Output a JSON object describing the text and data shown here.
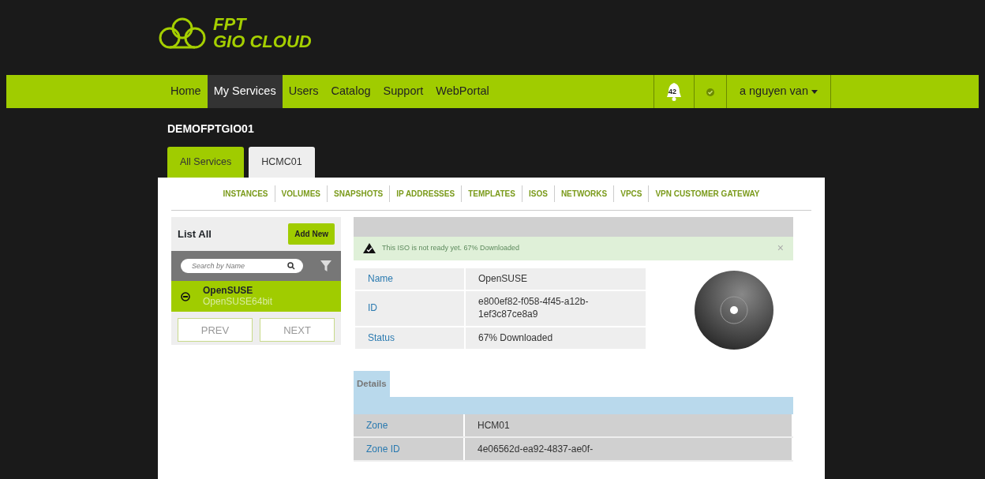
{
  "logo": {
    "line_1": "FPT",
    "line_2": "GIO CLOUD"
  },
  "nav": [
    {
      "label": "Home",
      "selected": false
    },
    {
      "label": "My Services",
      "selected": true
    },
    {
      "label": "Users",
      "selected": false
    },
    {
      "label": "Catalog",
      "selected": false
    },
    {
      "label": "Support",
      "selected": false
    },
    {
      "label": "WebPortal",
      "selected": false
    }
  ],
  "notifications": {
    "count": "42"
  },
  "user": {
    "name": "a nguyen van"
  },
  "account": "DEMOFPTGIO01",
  "tabs": [
    {
      "label": "All Services",
      "selected": true
    },
    {
      "label": "HCMC01",
      "selected": false
    }
  ],
  "subnav": [
    "INSTANCES",
    "VOLUMES",
    "SNAPSHOTS",
    "IP ADDRESSES",
    "TEMPLATES",
    "ISOS",
    "NETWORKS",
    "VPCS",
    "VPN CUSTOMER GATEWAY"
  ],
  "list": {
    "title": "List All",
    "add_button": "Add New",
    "search": {
      "placeholder": "Search by Name"
    },
    "items": [
      {
        "name": "OpenSUSE",
        "subtitle": "OpenSUSE64bit",
        "selected": true
      }
    ],
    "prev": "PREV",
    "next": "NEXT"
  },
  "alert": {
    "message": "This ISO is not ready yet. 67% Downloaded",
    "close": "×"
  },
  "info": [
    {
      "label": "Name",
      "value": "OpenSUSE"
    },
    {
      "label": "ID",
      "value": "e800ef82-f058-4f45-a12b-1ef3c87ce8a9"
    },
    {
      "label": "Status",
      "value": "67% Downloaded"
    }
  ],
  "detail_tabs": [
    {
      "label": "Details",
      "selected": true
    }
  ],
  "details": [
    {
      "label": "Zone",
      "value": "HCM01"
    },
    {
      "label": "Zone ID",
      "value": "4e06562d-ea92-4837-ae0f-"
    }
  ]
}
